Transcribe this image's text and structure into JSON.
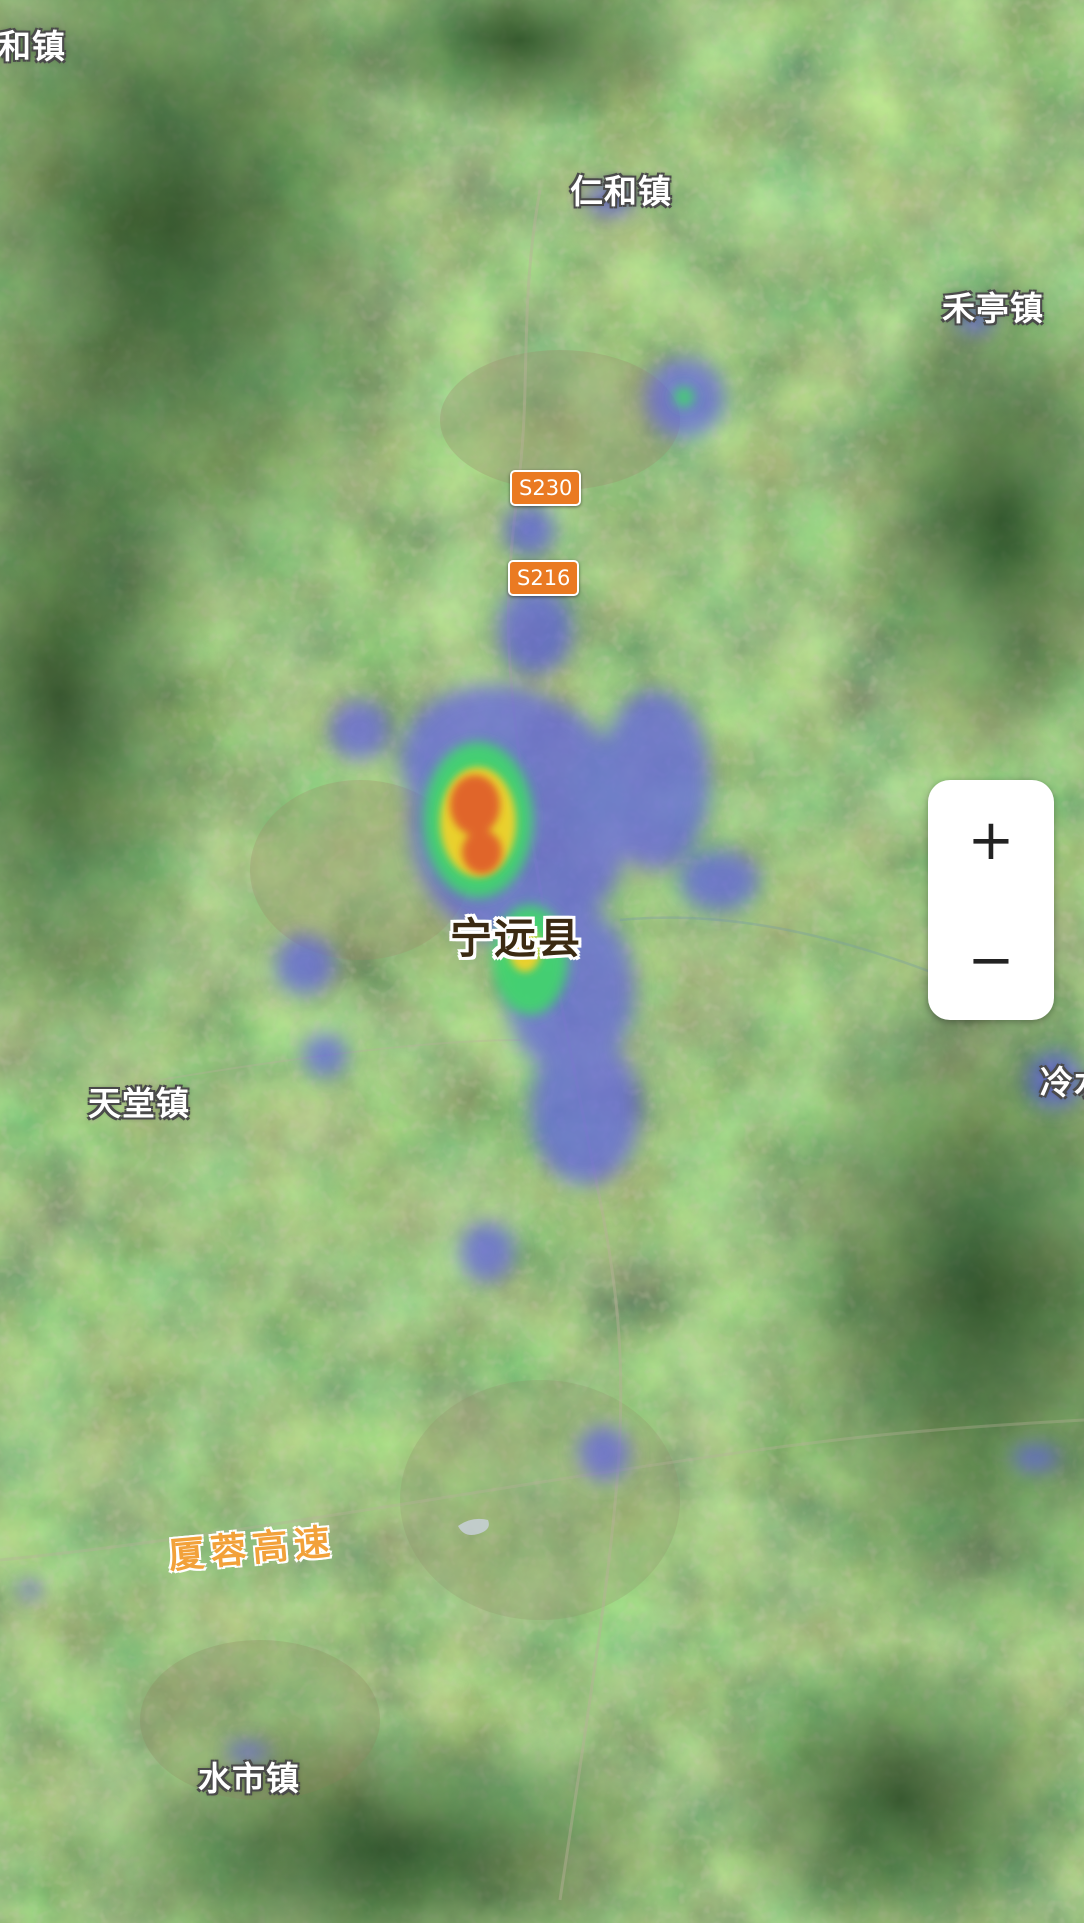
{
  "map": {
    "type": "satellite-heatmap",
    "heat_colors": {
      "low": "#5a5ce0",
      "mid": "#3fd86a",
      "high": "#f2d12b",
      "peak": "#e0602a"
    }
  },
  "places": {
    "hehe_town_partial": "和镇",
    "renhe_town": "仁和镇",
    "heting_town": "禾亭镇",
    "tiantang_town": "天堂镇",
    "shuishi_town": "水市镇",
    "leng_partial": "冷水"
  },
  "county": {
    "name": "宁远县"
  },
  "roads": {
    "s230": "S230",
    "s216": "S216",
    "expressway": "厦蓉高速"
  },
  "zoom": {
    "in_label": "+",
    "out_label": "−",
    "in_icon": "plus-icon",
    "out_icon": "minus-icon"
  }
}
